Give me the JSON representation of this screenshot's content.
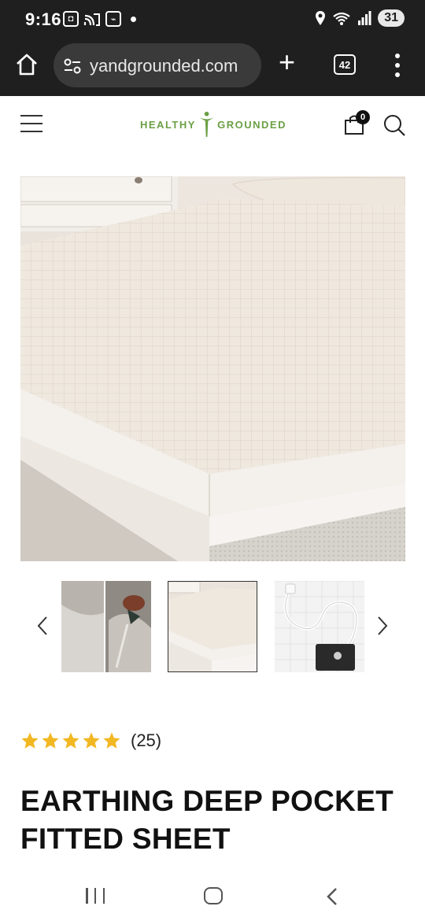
{
  "status_bar": {
    "time": "9:16",
    "battery": "31",
    "icons": [
      "screenshot-icon",
      "cast-icon",
      "app-icon",
      "location-icon",
      "wifi-icon",
      "signal-icon"
    ]
  },
  "browser": {
    "url": "yandgrounded.com",
    "tab_count": "42",
    "icons": [
      "home-icon",
      "site-settings-icon",
      "new-tab-icon",
      "menu-icon"
    ]
  },
  "site_header": {
    "logo_left": "HEALTHY",
    "logo_right": "GROUNDED",
    "cart_count": "0",
    "brand_color": "#6ba046"
  },
  "product": {
    "rating_stars": 5,
    "rating_count": "(25)",
    "title": "EARTHING DEEP POCKET FITTED SHEET",
    "star_color": "#f2b824",
    "thumbnails": [
      "sheet-detail-thumbnail",
      "bed-sheet-thumbnail",
      "grounding-cord-thumbnail"
    ],
    "selected_thumbnail": 1
  },
  "nav_bar": {
    "buttons": [
      "recent-apps",
      "home",
      "back"
    ]
  }
}
